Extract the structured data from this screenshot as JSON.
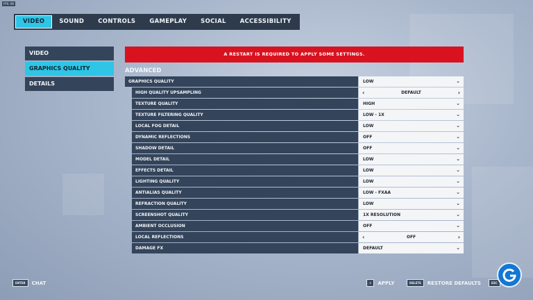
{
  "fps_counter": "FPS: 69",
  "top_tabs": [
    {
      "label": "VIDEO",
      "active": true
    },
    {
      "label": "SOUND",
      "active": false
    },
    {
      "label": "CONTROLS",
      "active": false
    },
    {
      "label": "GAMEPLAY",
      "active": false
    },
    {
      "label": "SOCIAL",
      "active": false
    },
    {
      "label": "ACCESSIBILITY",
      "active": false
    }
  ],
  "side_menu": [
    {
      "label": "VIDEO",
      "active": false
    },
    {
      "label": "GRAPHICS QUALITY",
      "active": true
    },
    {
      "label": "DETAILS",
      "active": false
    }
  ],
  "banner": "A RESTART IS REQUIRED TO APPLY SOME SETTINGS.",
  "section_title": "ADVANCED",
  "settings": [
    {
      "label": "GRAPHICS QUALITY",
      "value": "LOW",
      "control": "dropdown",
      "indent": false
    },
    {
      "label": "HIGH QUALITY UPSAMPLING",
      "value": "DEFAULT",
      "control": "arrows",
      "indent": true
    },
    {
      "label": "TEXTURE QUALITY",
      "value": "HIGH",
      "control": "dropdown",
      "indent": true
    },
    {
      "label": "TEXTURE FILTERING QUALITY",
      "value": "LOW - 1X",
      "control": "dropdown",
      "indent": true
    },
    {
      "label": "LOCAL FOG DETAIL",
      "value": "LOW",
      "control": "dropdown",
      "indent": true
    },
    {
      "label": "DYNAMIC REFLECTIONS",
      "value": "OFF",
      "control": "dropdown",
      "indent": true
    },
    {
      "label": "SHADOW DETAIL",
      "value": "OFF",
      "control": "dropdown",
      "indent": true
    },
    {
      "label": "MODEL DETAIL",
      "value": "LOW",
      "control": "dropdown",
      "indent": true
    },
    {
      "label": "EFFECTS DETAIL",
      "value": "LOW",
      "control": "dropdown",
      "indent": true
    },
    {
      "label": "LIGHTING QUALITY",
      "value": "LOW",
      "control": "dropdown",
      "indent": true
    },
    {
      "label": "ANTIALIAS QUALITY",
      "value": "LOW - FXAA",
      "control": "dropdown",
      "indent": true
    },
    {
      "label": "REFRACTION QUALITY",
      "value": "LOW",
      "control": "dropdown",
      "indent": true
    },
    {
      "label": "SCREENSHOT QUALITY",
      "value": "1X RESOLUTION",
      "control": "dropdown",
      "indent": true
    },
    {
      "label": "AMBIENT OCCLUSION",
      "value": "OFF",
      "control": "dropdown",
      "indent": true
    },
    {
      "label": "LOCAL REFLECTIONS",
      "value": "OFF",
      "control": "arrows",
      "indent": true
    },
    {
      "label": "DAMAGE FX",
      "value": "DEFAULT",
      "control": "dropdown",
      "indent": true
    }
  ],
  "footer": {
    "chat_key": "ENTER",
    "chat_label": "CHAT",
    "apply_key": "+",
    "apply_label": "APPLY",
    "restore_key": "DELETE",
    "restore_label": "RESTORE DEFAULTS",
    "esc_key": "ESC"
  },
  "colors": {
    "accent": "#2ec5e6",
    "panel": "#34445a",
    "banner": "#d9121f",
    "value_bg": "#f4f5f7",
    "logo": "#1377d3"
  }
}
